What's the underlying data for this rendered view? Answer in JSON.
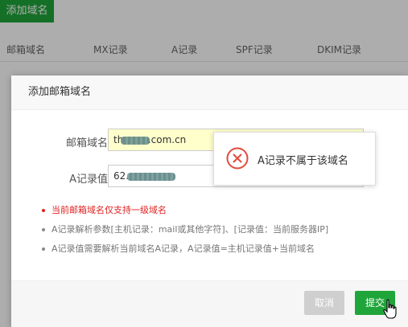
{
  "toolbar": {
    "add_domain_label": "添加域名"
  },
  "table": {
    "headers": [
      "邮箱域名",
      "MX记录",
      "A记录",
      "SPF记录",
      "DKIM记录"
    ]
  },
  "modal": {
    "title": "添加邮箱域名",
    "fields": {
      "domain_label": "邮箱域名",
      "domain_value": "th        .com.cn",
      "a_record_label": "A记录值",
      "a_record_value": "62."
    },
    "tips": [
      "当前邮箱域名仅支持一级域名",
      "A记录解析参数[主机记录：mail或其他字符]、[记录值：当前服务器IP]",
      "A记录值需要解析当前域名A记录，A记录值=主机记录值+当前域名"
    ],
    "buttons": {
      "cancel": "取消",
      "submit": "提交"
    }
  },
  "toast": {
    "message": "A记录不属于该域名",
    "icon": "error-circle-icon"
  },
  "colors": {
    "primary": "#20a53a",
    "error": "#e02020",
    "input_highlight": "#ffffcc"
  }
}
